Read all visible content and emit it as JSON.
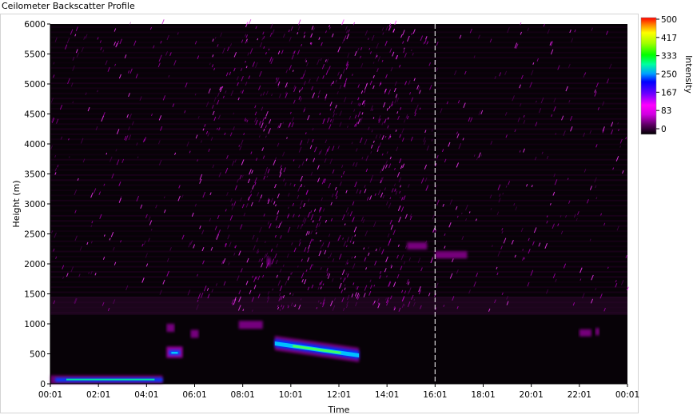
{
  "chart_data": {
    "type": "heatmap",
    "title": "Ceilometer Backscatter Profile",
    "xlabel": "Time",
    "ylabel": "Height (m)",
    "x_ticks": [
      "00:01",
      "02:01",
      "04:01",
      "06:01",
      "08:01",
      "10:01",
      "12:01",
      "14:01",
      "16:01",
      "18:01",
      "20:01",
      "22:01",
      "00:01"
    ],
    "y_ticks": [
      "0",
      "500",
      "1000",
      "1500",
      "2000",
      "2500",
      "3000",
      "3500",
      "4000",
      "4500",
      "5000",
      "5500",
      "6000"
    ],
    "ylim": [
      0,
      6000
    ],
    "colorbar": {
      "label": "Intensity",
      "range": [
        0,
        500
      ],
      "ticks": [
        "500",
        "417",
        "333",
        "250",
        "167",
        "83",
        "0"
      ],
      "colors": [
        "#000000",
        "#5a0060",
        "#b000c0",
        "#ff00ff",
        "#6a00ff",
        "#0000ff",
        "#00a0ff",
        "#00ffa0",
        "#00ff00",
        "#a0ff00",
        "#ffff00",
        "#ff8000",
        "#ff0000"
      ]
    },
    "features": [
      {
        "name": "surface layer",
        "time_start": "00:01",
        "time_end": "04:41",
        "height": 70,
        "intensity": 230
      },
      {
        "name": "layer",
        "time_start": "04:51",
        "time_end": "05:31",
        "height": 500,
        "intensity": 230
      },
      {
        "name": "cloud layer",
        "time_start": "09:21",
        "time_end": "12:51",
        "height": 600,
        "intensity": 300
      },
      {
        "name": "gap",
        "time": "16:01",
        "type": "missing data"
      }
    ],
    "grid": false
  }
}
